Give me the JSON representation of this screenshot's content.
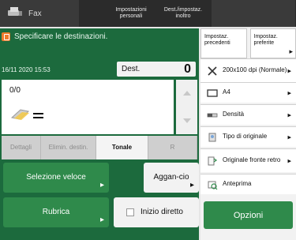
{
  "top": {
    "app_label": "Fax",
    "tabs": [
      "Impostazioni personali",
      "Dest./impostaz. inoltro"
    ]
  },
  "main": {
    "title": "Specificare le destinazioni.",
    "datetime": "16/11 2020 15:53",
    "dest_label": "Dest.",
    "dest_count": "0",
    "list": {
      "counter": "0/0",
      "fax_icon": "fax-document-icon"
    },
    "tabs": [
      {
        "label": "Dettagli",
        "active": false
      },
      {
        "label": "Elimin. destin.",
        "active": false
      },
      {
        "label": "Tonale",
        "active": true
      },
      {
        "label": "R",
        "active": false
      }
    ],
    "buttons": {
      "selezione": "Selezione veloce",
      "aggancio": "Aggan-cio",
      "rubrica": "Rubrica",
      "inizio_diretto": "Inizio diretto"
    }
  },
  "right": {
    "prev_settings": "Impostaz. precedenti",
    "fav_settings": "Impostaz. preferite",
    "items": [
      {
        "icon": "resolution-icon",
        "label": "200x100 dpi (Normale)"
      },
      {
        "icon": "paper-icon",
        "label": "A4"
      },
      {
        "icon": "density-icon",
        "label": "Densità"
      },
      {
        "icon": "original-type-icon",
        "label": "Tipo di originale"
      },
      {
        "icon": "duplex-original-icon",
        "label": "Originale fronte retro"
      },
      {
        "icon": "preview-icon",
        "label": "Anteprima"
      }
    ],
    "options_button": "Opzioni"
  },
  "colors": {
    "primary_green": "#1c6a3d",
    "button_green": "#2f8a4b",
    "warning_orange": "#f07a2b"
  }
}
